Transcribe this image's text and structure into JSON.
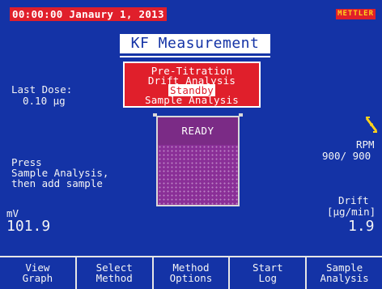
{
  "header": {
    "datetime": "00:00:00 Janaury 1, 2013",
    "logo": "METTLER"
  },
  "title": "KF Measurement",
  "states": {
    "items": [
      "Pre-Titration",
      "Drift Analysis",
      "Standby",
      "Sample Analysis"
    ],
    "active": "Standby"
  },
  "last_dose": {
    "label": "Last Dose:",
    "value": "0.10 µg"
  },
  "stirrer": {
    "icon": "stirrer-icon",
    "label": "RPM",
    "value": "900/ 900"
  },
  "status": {
    "beaker_text": "READY"
  },
  "instruction": {
    "line1": "Press",
    "line2": "Sample Analysis,",
    "line3": "then add sample"
  },
  "potential": {
    "unit": "mV",
    "value": "101.9"
  },
  "drift": {
    "label": "Drift",
    "unit": "[µg/min]",
    "value": "1.9"
  },
  "softkeys": [
    "View\nGraph",
    "Select\nMethod",
    "Method\nOptions",
    "Start\nLog",
    "Sample\nAnalysis"
  ],
  "colors": {
    "background": "#1433a6",
    "accent_red": "#e01f2b",
    "beaker_purple": "#7b2b86"
  }
}
